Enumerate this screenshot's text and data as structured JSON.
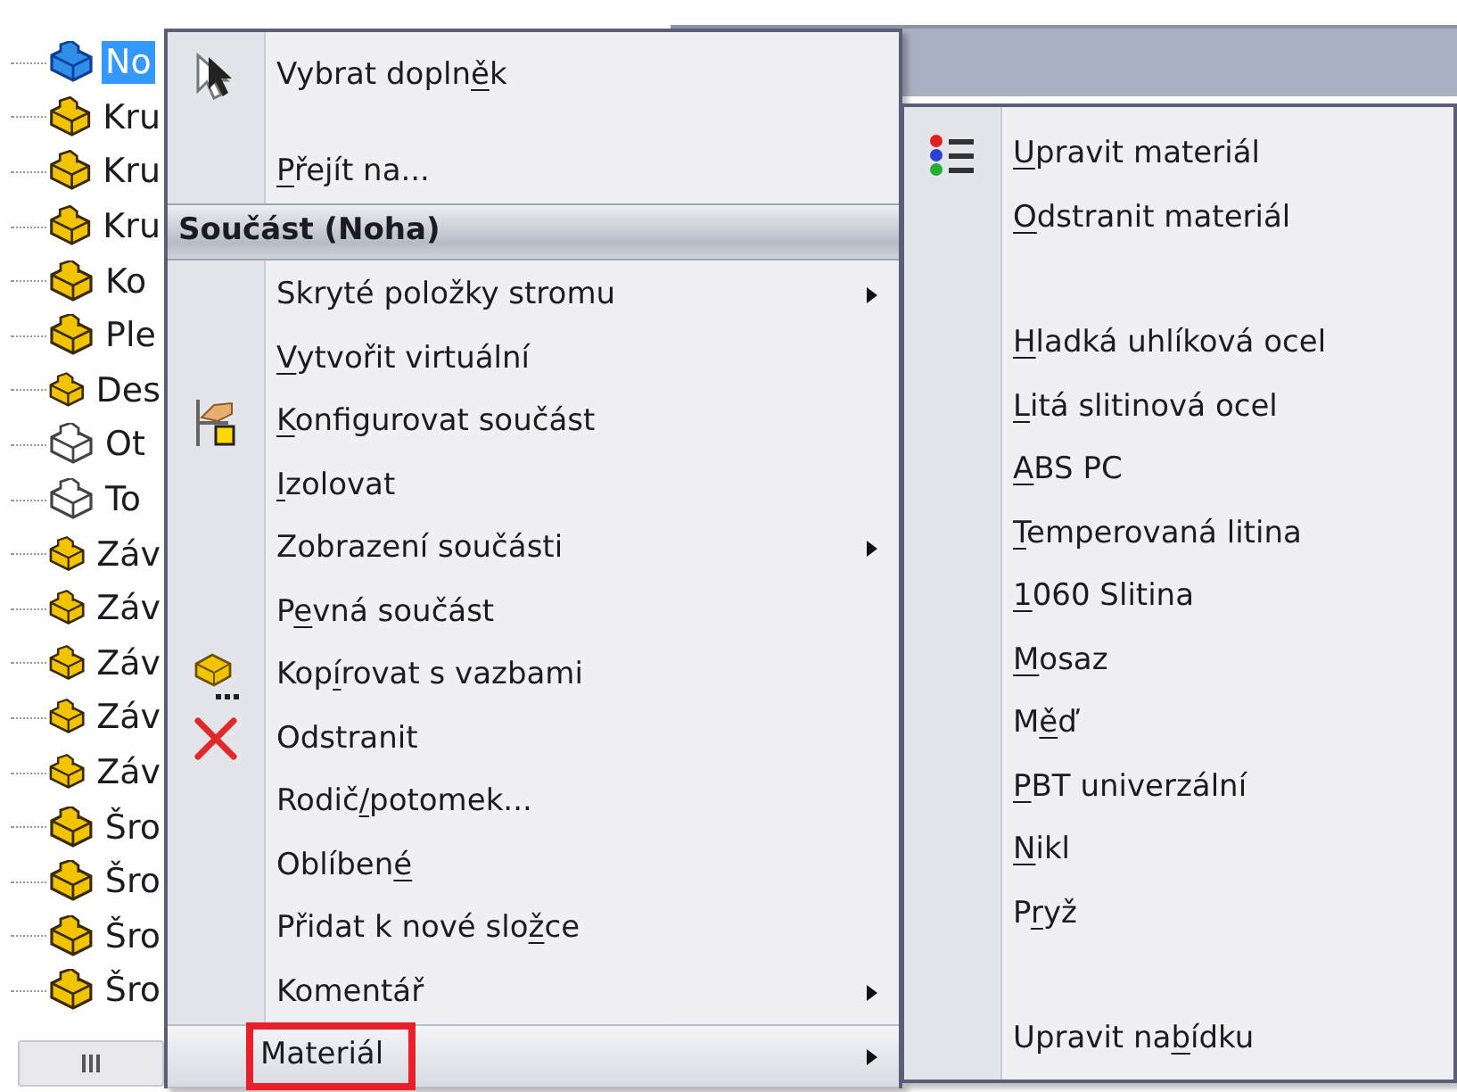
{
  "tree": {
    "items": [
      {
        "label": "No",
        "kind": "part",
        "selected": true
      },
      {
        "label": "Kru",
        "kind": "part",
        "selected": false
      },
      {
        "label": "Kru",
        "kind": "part",
        "selected": false
      },
      {
        "label": "Kru",
        "kind": "part",
        "selected": false
      },
      {
        "label": "Ko",
        "kind": "part",
        "selected": false
      },
      {
        "label": "Ple",
        "kind": "part",
        "selected": false
      },
      {
        "label": "Des",
        "kind": "part",
        "selected": false
      },
      {
        "label": "Ot",
        "kind": "outline",
        "selected": false
      },
      {
        "label": "To",
        "kind": "outline",
        "selected": false
      },
      {
        "label": "Záv",
        "kind": "part",
        "selected": false
      },
      {
        "label": "Záv",
        "kind": "part",
        "selected": false
      },
      {
        "label": "Záv",
        "kind": "part",
        "selected": false
      },
      {
        "label": "Záv",
        "kind": "part",
        "selected": false
      },
      {
        "label": "Záv",
        "kind": "part",
        "selected": false
      },
      {
        "label": "Šro",
        "kind": "part",
        "selected": false
      },
      {
        "label": "Šro",
        "kind": "part",
        "selected": false
      },
      {
        "label": "Šro",
        "kind": "part",
        "selected": false
      },
      {
        "label": "Šro",
        "kind": "part",
        "selected": false
      }
    ]
  },
  "context_menu": {
    "items": [
      {
        "kind": "cursor",
        "before": "Vybrat dopln",
        "key": "ě",
        "after": "k",
        "submenu": false,
        "highlighted": false
      },
      {
        "kind": "separator"
      },
      {
        "kind": "plain",
        "key": "P",
        "after": "řejít na...",
        "submenu": false,
        "highlighted": false
      },
      {
        "kind": "header",
        "label": "Součást (Noha)"
      },
      {
        "kind": "plain",
        "before": "Skryté položky stromu",
        "submenu": true,
        "highlighted": false
      },
      {
        "kind": "plain",
        "key": "V",
        "after": "ytvořit virtuální",
        "submenu": false,
        "highlighted": false
      },
      {
        "kind": "configure",
        "key": "K",
        "after": "onfigurovat součást",
        "submenu": false,
        "highlighted": false
      },
      {
        "kind": "plain",
        "key": "I",
        "after": "zolovat",
        "submenu": false,
        "highlighted": false
      },
      {
        "kind": "plain",
        "before": "Zobrazení součásti",
        "submenu": true,
        "highlighted": false
      },
      {
        "kind": "plain",
        "before": "P",
        "key": "e",
        "after": "vná součást",
        "submenu": false,
        "highlighted": false
      },
      {
        "kind": "copy",
        "before": "Kop",
        "key": "í",
        "after": "rovat s vazbami",
        "submenu": false,
        "highlighted": false
      },
      {
        "kind": "delete",
        "before": "Odstranit",
        "submenu": false,
        "highlighted": false
      },
      {
        "kind": "plain",
        "before": "Rodič",
        "key": "/",
        "after": "potomek...",
        "submenu": false,
        "highlighted": false
      },
      {
        "kind": "plain",
        "before": "Oblíben",
        "key": "é",
        "submenu": false,
        "highlighted": false
      },
      {
        "kind": "plain",
        "before": "Přidat k nové slo",
        "key": "ž",
        "after": "ce",
        "submenu": false,
        "highlighted": false
      },
      {
        "kind": "plain",
        "before": "Komentář",
        "submenu": true,
        "highlighted": false
      },
      {
        "kind": "plain",
        "before": "Materiál",
        "submenu": true,
        "highlighted": true,
        "annotated": true
      }
    ]
  },
  "material_submenu": {
    "items": [
      {
        "kind": "material",
        "key": "U",
        "after": "pravit materiál"
      },
      {
        "kind": "plain",
        "key": "O",
        "after": "dstranit materiál"
      },
      {
        "kind": "separator"
      },
      {
        "kind": "plain",
        "key": "H",
        "after": "ladká uhlíková ocel"
      },
      {
        "kind": "plain",
        "key": "L",
        "after": "itá slitinová ocel"
      },
      {
        "kind": "plain",
        "key": "A",
        "after": "BS PC"
      },
      {
        "kind": "plain",
        "key": "T",
        "after": "emperovaná litina"
      },
      {
        "kind": "plain",
        "key": "1",
        "after": "060 Slitina"
      },
      {
        "kind": "plain",
        "key": "M",
        "after": "osaz"
      },
      {
        "kind": "plain",
        "before": "M",
        "key": "ě",
        "after": "ď"
      },
      {
        "kind": "plain",
        "key": "P",
        "after": "BT univerzální"
      },
      {
        "kind": "plain",
        "key": "N",
        "after": "ikl"
      },
      {
        "kind": "plain",
        "before": "P",
        "key": "r",
        "after": "yž"
      },
      {
        "kind": "separator"
      },
      {
        "kind": "plain",
        "before": "Upravit na",
        "key": "b",
        "after": "ídku"
      }
    ]
  }
}
